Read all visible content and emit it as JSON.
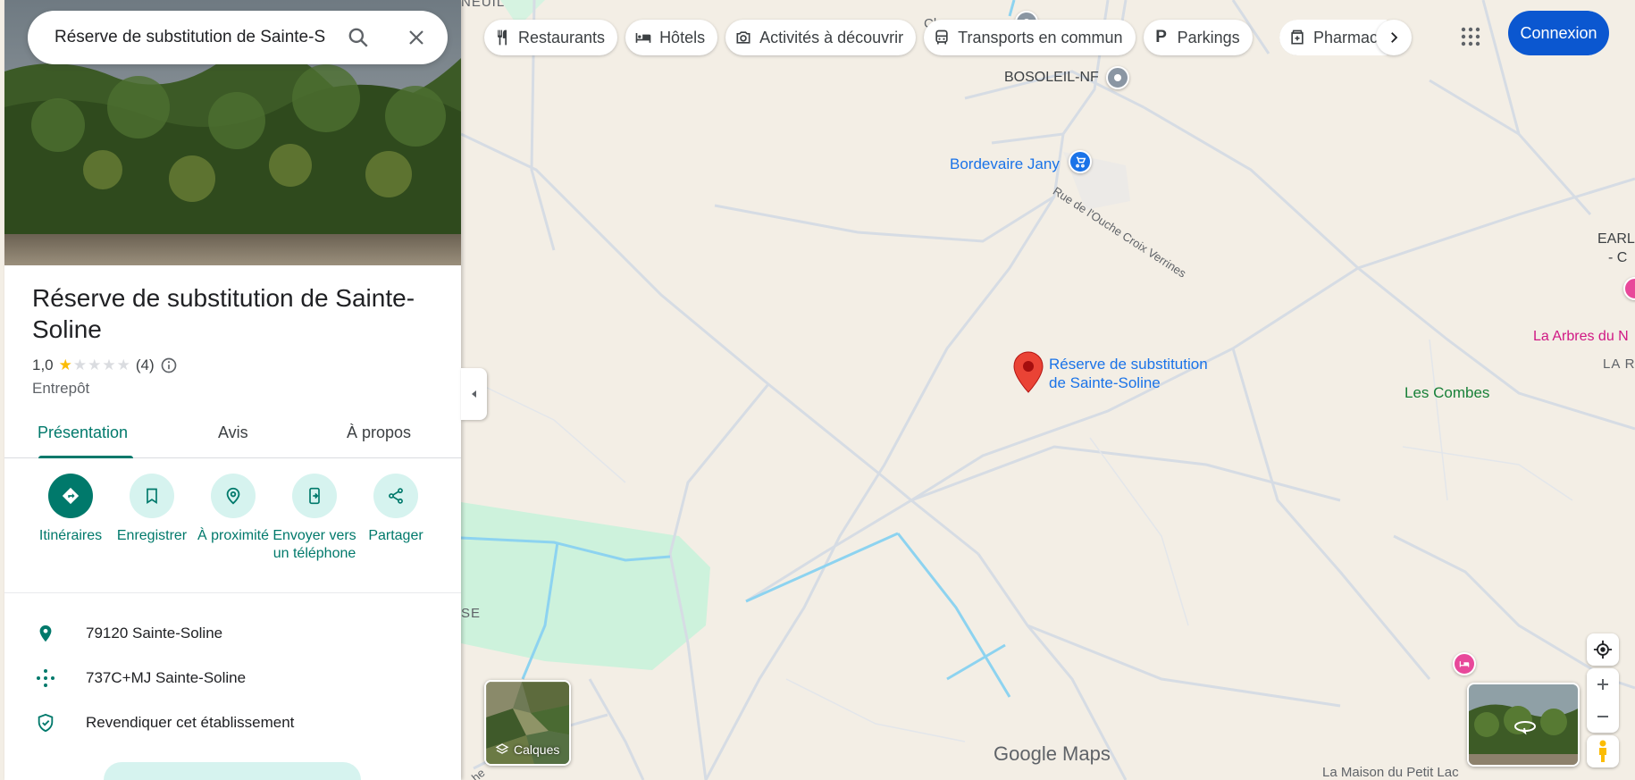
{
  "search": {
    "value": "Réserve de substitution de Sainte-S"
  },
  "place": {
    "title": "Réserve de substitution de Sainte-Soline",
    "rating": "1,0",
    "reviews": "(4)",
    "category": "Entrepôt",
    "tabs": [
      {
        "label": "Présentation"
      },
      {
        "label": "Avis"
      },
      {
        "label": "À propos"
      }
    ],
    "actions": [
      {
        "label": "Itinéraires"
      },
      {
        "label": "Enregistrer"
      },
      {
        "label": "À proximité"
      },
      {
        "label": "Envoyer vers un téléphone"
      },
      {
        "label": "Partager"
      }
    ],
    "address": "79120 Sainte-Soline",
    "plus_code": "737C+MJ Sainte-Soline",
    "claim": "Revendiquer cet établissement"
  },
  "chips": [
    {
      "label": "Restaurants",
      "icon": "fork-knife-icon"
    },
    {
      "label": "Hôtels",
      "icon": "bed-icon"
    },
    {
      "label": "Activités à découvrir",
      "icon": "camera-icon"
    },
    {
      "label": "Transports en commun",
      "icon": "bus-icon"
    },
    {
      "label": "Parkings",
      "icon": "parking-icon"
    },
    {
      "label": "Pharmac",
      "icon": "pharmacy-icon"
    }
  ],
  "header": {
    "signin": "Connexion"
  },
  "map": {
    "labels": {
      "bosoleil": "BOSOLEIL-NF",
      "bordevaire": "Bordevaire Jany",
      "street": "Rue de l'Ouche Croix Verrines",
      "marker_line1": "Réserve de substitution",
      "marker_line2": "de Sainte-Soline",
      "combes": "Les Combes",
      "earl1": "EARL",
      "earl2": "- C",
      "arbres": "La Arbres du N",
      "la_r": "LA R",
      "neuil": "NEUIL",
      "cla": "Cla",
      "se": "SE",
      "petit_lac": "La Maison du Petit Lac",
      "he": "he"
    },
    "layers_label": "Calques",
    "logo": "Google Maps"
  },
  "colors": {
    "accent": "#00796b",
    "signin": "#0b57d0",
    "marker": "#ea4335"
  }
}
